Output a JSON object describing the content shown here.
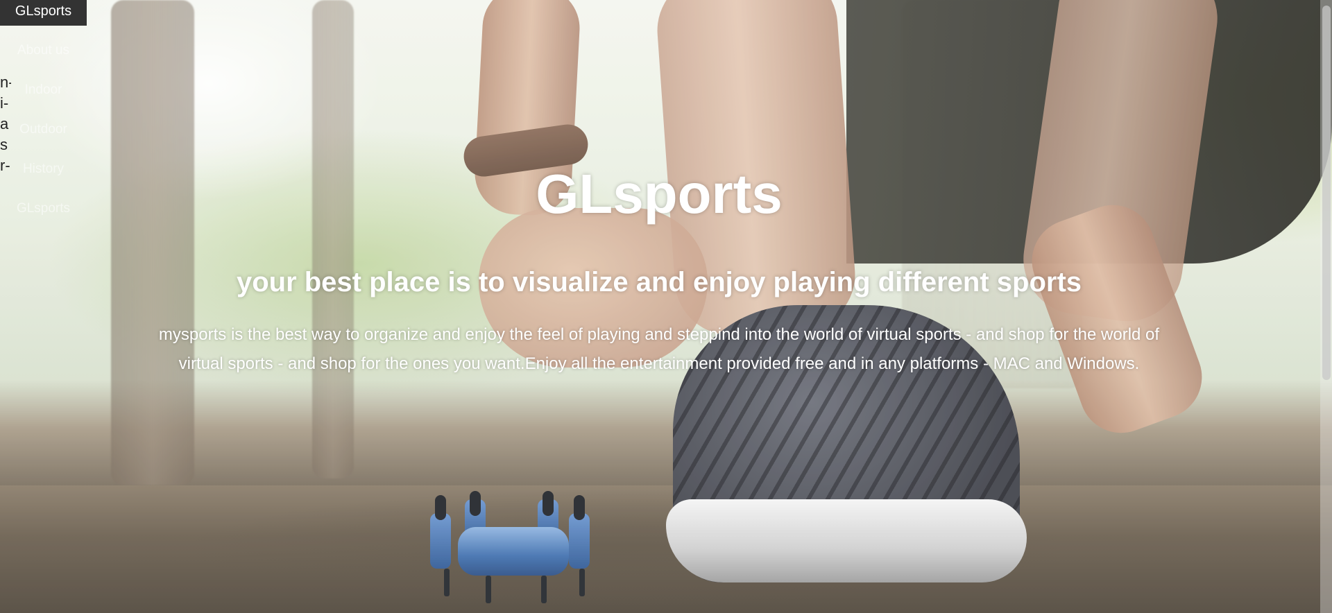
{
  "nav": {
    "brand": "GLsports",
    "items": [
      {
        "label": "About us"
      },
      {
        "label": "Indoor"
      },
      {
        "label": "Outdoor"
      },
      {
        "label": "History"
      },
      {
        "label": "GLsports"
      }
    ]
  },
  "side_text": [
    "n-",
    "i-",
    "a",
    "s",
    "r-"
  ],
  "hero": {
    "title": "GLsports",
    "tagline": "your best place is to visualize and enjoy playing different sports",
    "description": "mysports is the best way to organize and enjoy the feel of playing and steppind into the world of virtual sports - and shop for the world of virtual sports - and shop for the ones you want.Enjoy all the entertainment provided free and in any platforms - MAC and Windows."
  },
  "colors": {
    "brand_bg": "#333333",
    "text_on_hero": "#ffffff"
  }
}
